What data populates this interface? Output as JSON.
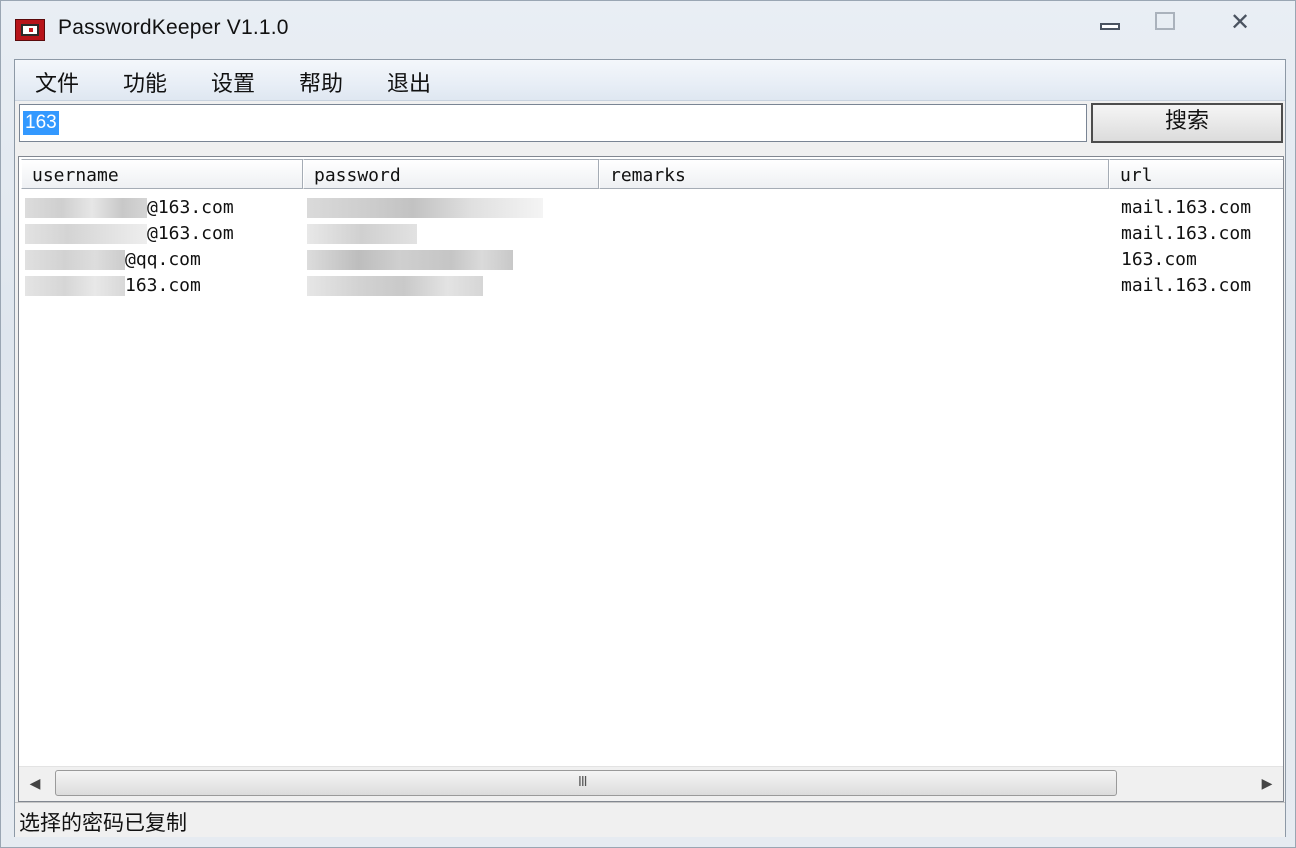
{
  "window": {
    "title": "PasswordKeeper V1.1.0"
  },
  "menu": {
    "items": [
      "文件",
      "功能",
      "设置",
      "帮助",
      "退出"
    ]
  },
  "search": {
    "value": "163",
    "button_label": "搜索"
  },
  "table": {
    "columns": [
      "username",
      "password",
      "remarks",
      "url"
    ],
    "rows": [
      {
        "username": "@163.com",
        "password": "",
        "remarks": "",
        "url": "mail.163.com"
      },
      {
        "username": "@163.com",
        "password": "",
        "remarks": "",
        "url": "mail.163.com"
      },
      {
        "username": "@qq.com",
        "password": "",
        "remarks": "",
        "url": "163.com"
      },
      {
        "username": "163.com",
        "password": "",
        "remarks": "",
        "url": "mail.163.com"
      }
    ]
  },
  "scrollbar": {
    "grip": "III",
    "left_arrow": "◀",
    "right_arrow": "▶"
  },
  "status": {
    "text": "选择的密码已复制"
  },
  "icons": [
    "app-icon",
    "minimize-icon",
    "maximize-icon",
    "close-icon"
  ]
}
